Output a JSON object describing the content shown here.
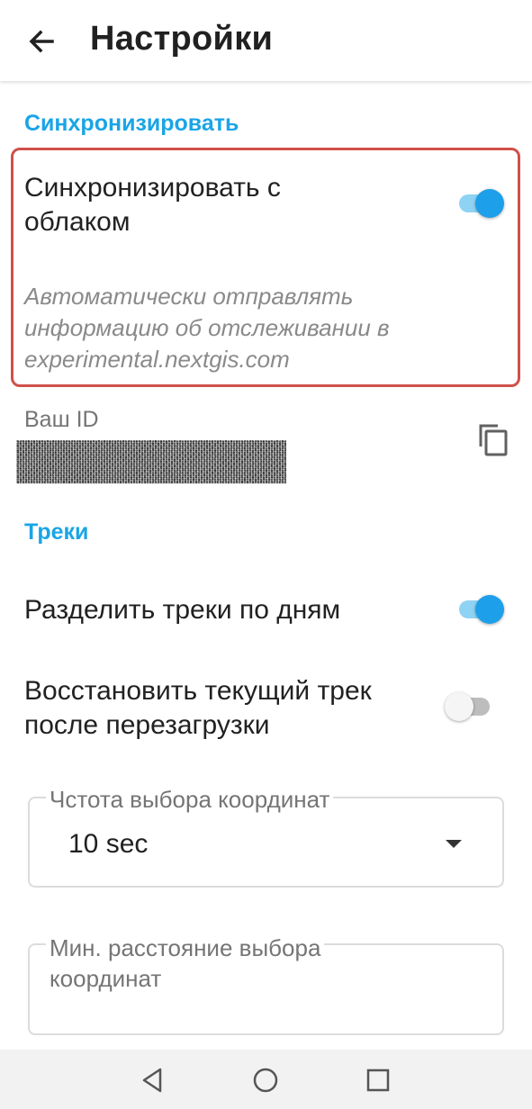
{
  "appbar": {
    "title": "Настройки",
    "back_icon": "arrow-back-icon"
  },
  "sections": {
    "sync_header": "Синхронизировать",
    "tracks_header": "Треки"
  },
  "sync": {
    "title_line1": "Синхронизировать с",
    "title_line2": "облаком",
    "summary_line1": "Автоматически отправлять",
    "summary_line2": "информацию об отслеживании в",
    "summary_line3": "experimental.nextgis.com",
    "enabled": true,
    "highlight_color": "#d0504a"
  },
  "user_id": {
    "label": "Ваш ID",
    "value": "",
    "copy_icon": "content-copy-icon"
  },
  "tracks": {
    "split_by_day": {
      "label": "Разделить треки по дням",
      "enabled": true
    },
    "restore_after_reboot": {
      "label_line1": "Восстановить текущий трек",
      "label_line2": "после перезагрузки",
      "enabled": false
    },
    "coordinate_rate": {
      "label": "Чстота выбора координат",
      "value": "10 sec"
    },
    "min_distance": {
      "label_line1": "Мин. расстояние выбора",
      "label_line2": "координат",
      "value": ""
    }
  },
  "colors": {
    "accent": "#1aa5e6",
    "switch_on_thumb": "#1e9fea",
    "switch_on_track": "#8fd3f4",
    "secondary_text": "#8a8a8a"
  },
  "navbar": {
    "back_icon": "nav-back-triangle-icon",
    "home_icon": "nav-home-circle-icon",
    "recents_icon": "nav-recents-square-icon"
  }
}
